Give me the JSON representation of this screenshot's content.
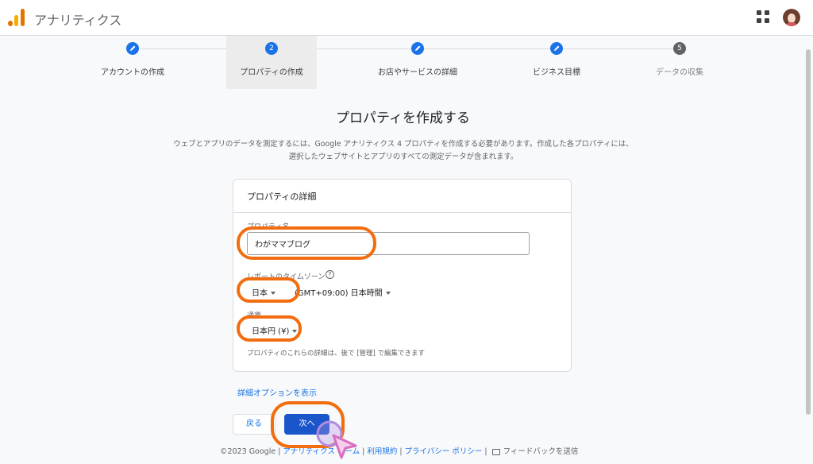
{
  "header": {
    "app_title": "アナリティクス",
    "logo_icon": "analytics-logo-icon",
    "apps_icon": "apps-grid-icon",
    "avatar_icon": "user-avatar"
  },
  "stepper": {
    "steps": [
      {
        "label": "アカウントの作成",
        "marker": "",
        "state": "done"
      },
      {
        "label": "プロパティの作成",
        "marker": "2",
        "state": "current"
      },
      {
        "label": "お店やサービスの詳細",
        "marker": "",
        "state": "done"
      },
      {
        "label": "ビジネス目標",
        "marker": "",
        "state": "done"
      },
      {
        "label": "データの収集",
        "marker": "5",
        "state": "pending"
      }
    ]
  },
  "main": {
    "title": "プロパティを作成する",
    "description": "ウェブとアプリのデータを測定するには、Google アナリティクス 4 プロパティを作成する必要があります。作成した各プロパティには、選択したウェブサイトとアプリのすべての測定データが含まれます。"
  },
  "card": {
    "title": "プロパティの詳細",
    "property_name_label": "プロパティ名",
    "property_name_value": "わがママブログ",
    "timezone_label": "レポートのタイムゾーン",
    "timezone_country": "日本",
    "timezone_value": "(GMT+09:00) 日本時間",
    "currency_label": "通貨",
    "currency_value": "日本円 (¥)",
    "hint": "プロパティのこれらの詳細は、後で [管理] で編集できます"
  },
  "actions": {
    "advanced_link": "詳細オプションを表示",
    "back_label": "戻る",
    "next_label": "次へ"
  },
  "footer": {
    "copyright": "©2023 Google",
    "home_link": "アナリティクス ホーム",
    "terms_link": "利用規約",
    "privacy_link": "プライバシー ポリシー",
    "feedback_label": "フィードバックを送信"
  },
  "colors": {
    "accent": "#1a73e8",
    "highlight": "#f26d0f"
  }
}
